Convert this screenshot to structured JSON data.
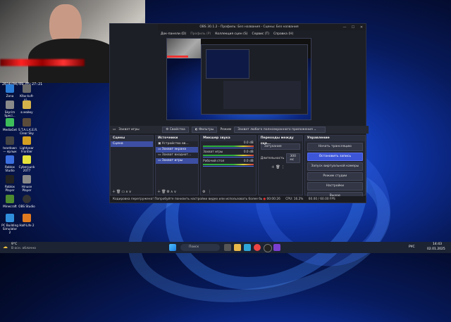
{
  "webcam": {
    "timestamp": "2024/04/09 05:27:21"
  },
  "desktop_icons": [
    {
      "label": "Zona",
      "color": "#2a7bd5"
    },
    {
      "label": "Kfav-kv9-vi...",
      "color": "#6b6b6b"
    },
    {
      "label": "Skyrim Speci...",
      "color": "#8a8a8a"
    },
    {
      "label": "в мейку",
      "color": "#d6b24a"
    },
    {
      "label": "MediaGet",
      "color": "#3dbd5a"
    },
    {
      "label": "S.T.A.L.K.E.R. Clear Sky",
      "color": "#5a4b3b"
    },
    {
      "label": "teardown — ярлык",
      "color": "#444"
    },
    {
      "label": "Lightyear Frontier",
      "color": "#d4a021"
    },
    {
      "label": "Roblox Studio",
      "color": "#3b6fe0"
    },
    {
      "label": "Cyberpunk 2077",
      "color": "#e5e33b"
    },
    {
      "label": "Roblox Player",
      "color": "#222"
    },
    {
      "label": "Hinuse Player",
      "color": "#888"
    },
    {
      "label": "Minecraft",
      "color": "#4e8a2f"
    },
    {
      "label": "OBS Studio",
      "color": "#333"
    },
    {
      "label": "PC Building Simulator 2",
      "color": "#2f8fdd"
    },
    {
      "label": "Half-Life 2",
      "color": "#e07a20"
    }
  ],
  "window": {
    "title": "OBS 30.1.2 - Профиль: Без названия - Сцены: Без названия",
    "wc": [
      "—",
      "☐",
      "✕"
    ]
  },
  "menu": [
    "Док-панели (D)",
    "Профиль (P)",
    "Коллекция сцен (S)",
    "Сервис (T)",
    "Справка (H)"
  ],
  "source_bar": {
    "source": "Захват игры",
    "props": "Свойства",
    "filters": "Фильтры",
    "mode_label": "Режим",
    "mode_value": "Захват любого полноэкранного приложения"
  },
  "scenes": {
    "title": "Сцены",
    "items": [
      "Сцена"
    ]
  },
  "sources": {
    "title": "Источники",
    "items": [
      "Устройство вв...",
      "Захват экрана",
      "Захват входнот...",
      "Захват игры"
    ]
  },
  "mixer": {
    "title": "Микшер звука",
    "channels": [
      {
        "name": "",
        "db": "0.0 dB"
      },
      {
        "name": "Захват игры",
        "db": "0.0 dB"
      },
      {
        "name": "Рабочий стол",
        "db": "0.0 dB"
      }
    ]
  },
  "transitions": {
    "title": "Переходы между сце...",
    "type": "Затухание",
    "duration_label": "Длительность",
    "duration_value": "300 мс"
  },
  "controls": {
    "title": "Управление",
    "buttons": [
      "Начать трансляцию",
      "Остановить запись",
      "Запуск виртуальной камеры",
      "Режим студии",
      "Настройки",
      "Выход"
    ]
  },
  "status": {
    "warning": "Кодировка перегружена! Попробуйте понизить настройки видео или использовать более быстрые пр...",
    "rec_time": "00:00:26",
    "cpu": "CPU: 16.2%",
    "fps": "60.00 / 60.00 FPS"
  },
  "taskbar": {
    "weather_temp": "9°C",
    "weather_text": "В осн. облачно",
    "search": "Поиск",
    "lang": "РУС",
    "time": "14:43",
    "date": "02.01.2025"
  }
}
